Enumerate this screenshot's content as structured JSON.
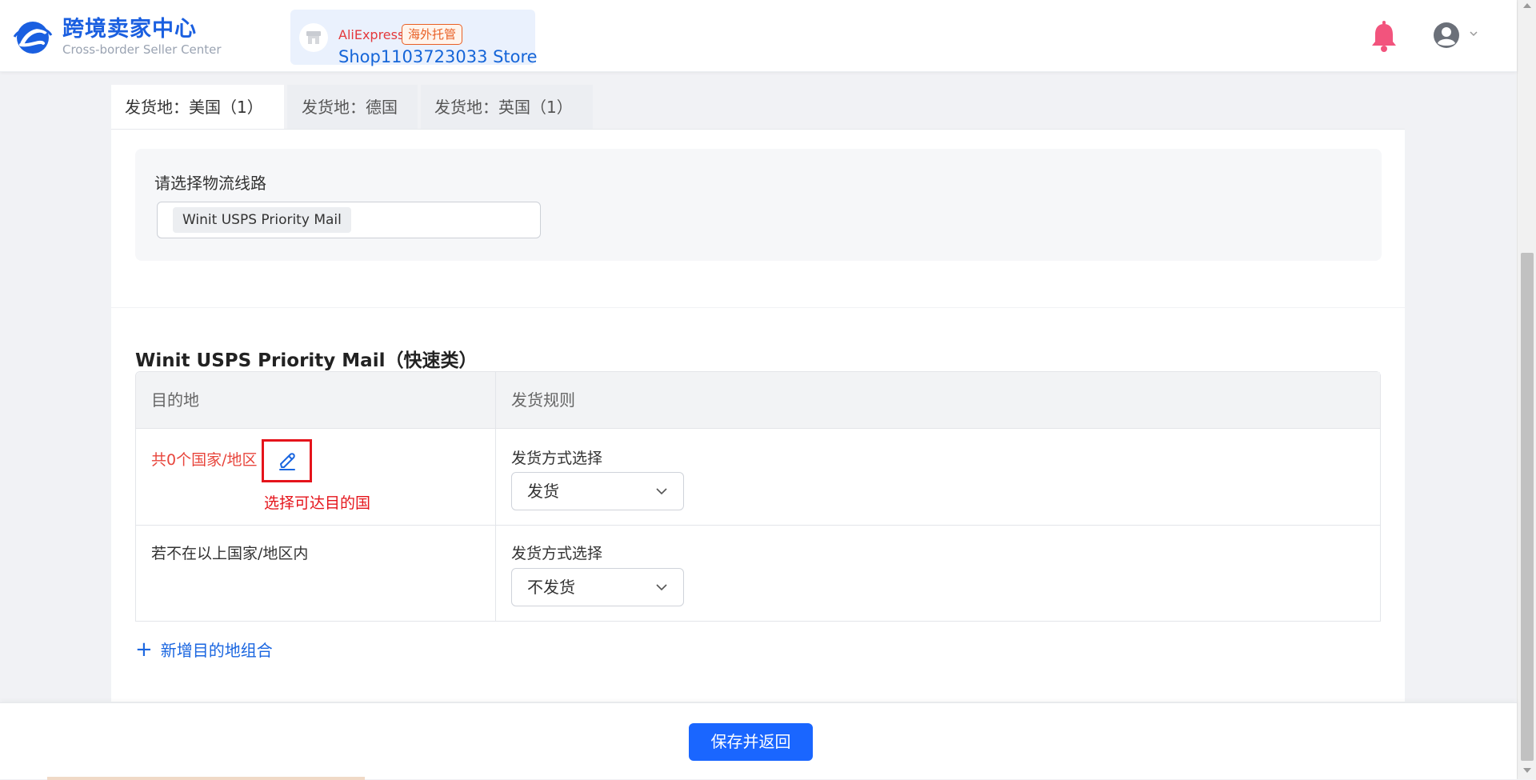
{
  "header": {
    "logo_title": "跨境卖家中心",
    "logo_subtitle": "Cross-border Seller Center",
    "store": {
      "brand": "AliExpress",
      "badge": "海外托管",
      "name": "Shop1103723033 Store"
    },
    "icons": {
      "notification": "bell-icon",
      "user": "user-circle-icon",
      "menu": "chevron-down-icon"
    }
  },
  "tabs": [
    {
      "label": "发货地：美国（1）",
      "active": true
    },
    {
      "label": "发货地：德国",
      "active": false
    },
    {
      "label": "发货地：英国（1）",
      "active": false
    }
  ],
  "route": {
    "label": "请选择物流线路",
    "selected_tag": "Winit USPS Priority Mail"
  },
  "section": {
    "title": "Winit USPS Priority Mail（快速类）",
    "table": {
      "headers": [
        "目的地",
        "发货规则"
      ],
      "rows": [
        {
          "destination": "共0个国家/地区",
          "annotation": "选择可达目的国",
          "method_label": "发货方式选择",
          "method_value": "发货"
        },
        {
          "destination": "若不在以上国家/地区内",
          "method_label": "发货方式选择",
          "method_value": "不发货"
        }
      ]
    },
    "add_link": "新增目的地组合",
    "add_icon": "+"
  },
  "footer": {
    "save_button": "保存并返回"
  },
  "colors": {
    "primary": "#1a66ff",
    "link": "#1a66e0",
    "warning_text": "#e8453c",
    "annotation_red": "#e5141b",
    "bell": "#f2547d",
    "brand_orange": "#e95f24"
  }
}
